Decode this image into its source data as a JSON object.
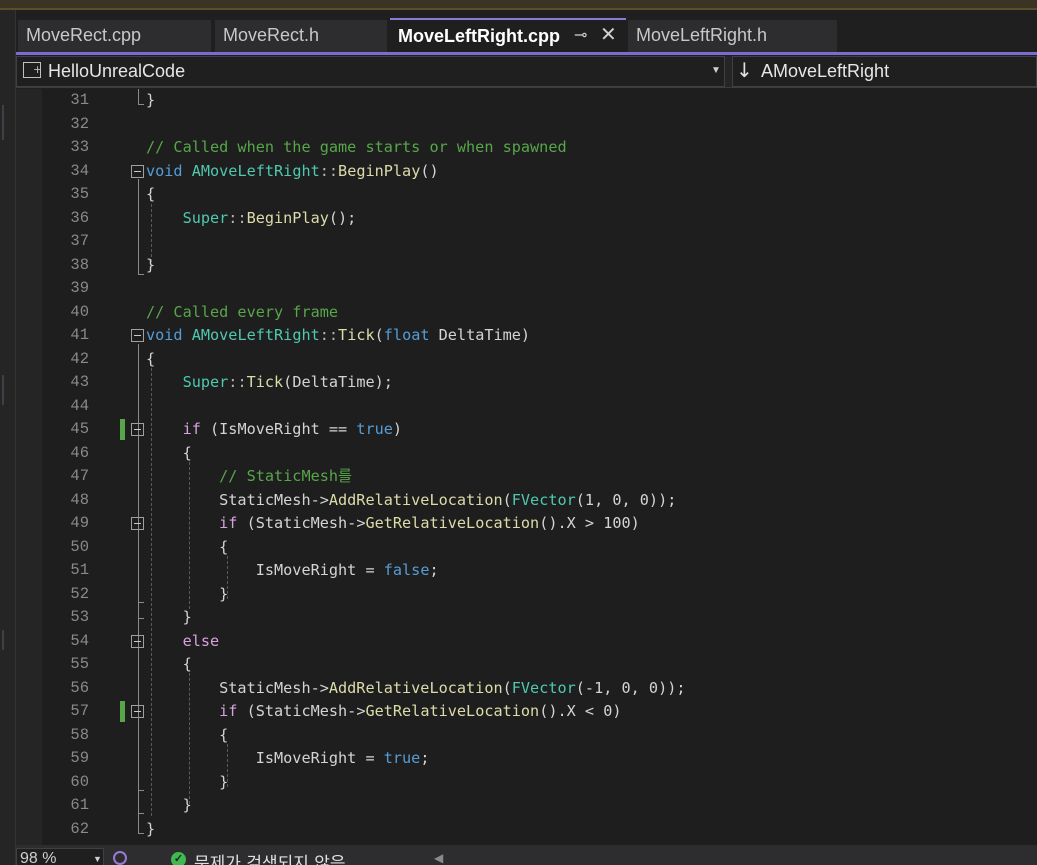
{
  "tabs": [
    {
      "label": "MoveRect.cpp",
      "active": false
    },
    {
      "label": "MoveRect.h",
      "active": false
    },
    {
      "label": "MoveLeftRight.cpp",
      "active": true
    },
    {
      "label": "MoveLeftRight.h",
      "active": false
    }
  ],
  "tab_icons": {
    "pin": "⊸",
    "close": "✕"
  },
  "navbar": {
    "project": "HelloUnrealCode",
    "scope_arrow": "↓",
    "scope": "AMoveLeftRight"
  },
  "colors": {
    "accent": "#7d6bd0",
    "changed_marker": "#57a64a",
    "comment": "#57a64a",
    "keyword": "#569cd6",
    "type": "#4ec9b0",
    "function": "#dcdcaa"
  },
  "lines": [
    {
      "n": "31",
      "code": "}"
    },
    {
      "n": "32",
      "code": ""
    },
    {
      "n": "33",
      "code": "// Called when the game starts or when spawned"
    },
    {
      "n": "34",
      "code": "void AMoveLeftRight::BeginPlay()"
    },
    {
      "n": "35",
      "code": "{"
    },
    {
      "n": "36",
      "code": "    Super::BeginPlay();"
    },
    {
      "n": "37",
      "code": ""
    },
    {
      "n": "38",
      "code": "}"
    },
    {
      "n": "39",
      "code": ""
    },
    {
      "n": "40",
      "code": "// Called every frame"
    },
    {
      "n": "41",
      "code": "void AMoveLeftRight::Tick(float DeltaTime)"
    },
    {
      "n": "42",
      "code": "{"
    },
    {
      "n": "43",
      "code": "    Super::Tick(DeltaTime);"
    },
    {
      "n": "44",
      "code": ""
    },
    {
      "n": "45",
      "code": "    if (IsMoveRight == true)"
    },
    {
      "n": "46",
      "code": "    {"
    },
    {
      "n": "47",
      "code": "        // StaticMesh를"
    },
    {
      "n": "48",
      "code": "        StaticMesh->AddRelativeLocation(FVector(1, 0, 0));"
    },
    {
      "n": "49",
      "code": "        if (StaticMesh->GetRelativeLocation().X > 100)"
    },
    {
      "n": "50",
      "code": "        {"
    },
    {
      "n": "51",
      "code": "            IsMoveRight = false;"
    },
    {
      "n": "52",
      "code": "        }"
    },
    {
      "n": "53",
      "code": "    }"
    },
    {
      "n": "54",
      "code": "    else"
    },
    {
      "n": "55",
      "code": "    {"
    },
    {
      "n": "56",
      "code": "        StaticMesh->AddRelativeLocation(FVector(-1, 0, 0));"
    },
    {
      "n": "57",
      "code": "        if (StaticMesh->GetRelativeLocation().X < 0)"
    },
    {
      "n": "58",
      "code": "        {"
    },
    {
      "n": "59",
      "code": "            IsMoveRight = true;"
    },
    {
      "n": "60",
      "code": "        }"
    },
    {
      "n": "61",
      "code": "    }"
    },
    {
      "n": "62",
      "code": "}"
    }
  ],
  "status": {
    "zoom": "98 %",
    "message": "문제가 검색되지 않음"
  }
}
